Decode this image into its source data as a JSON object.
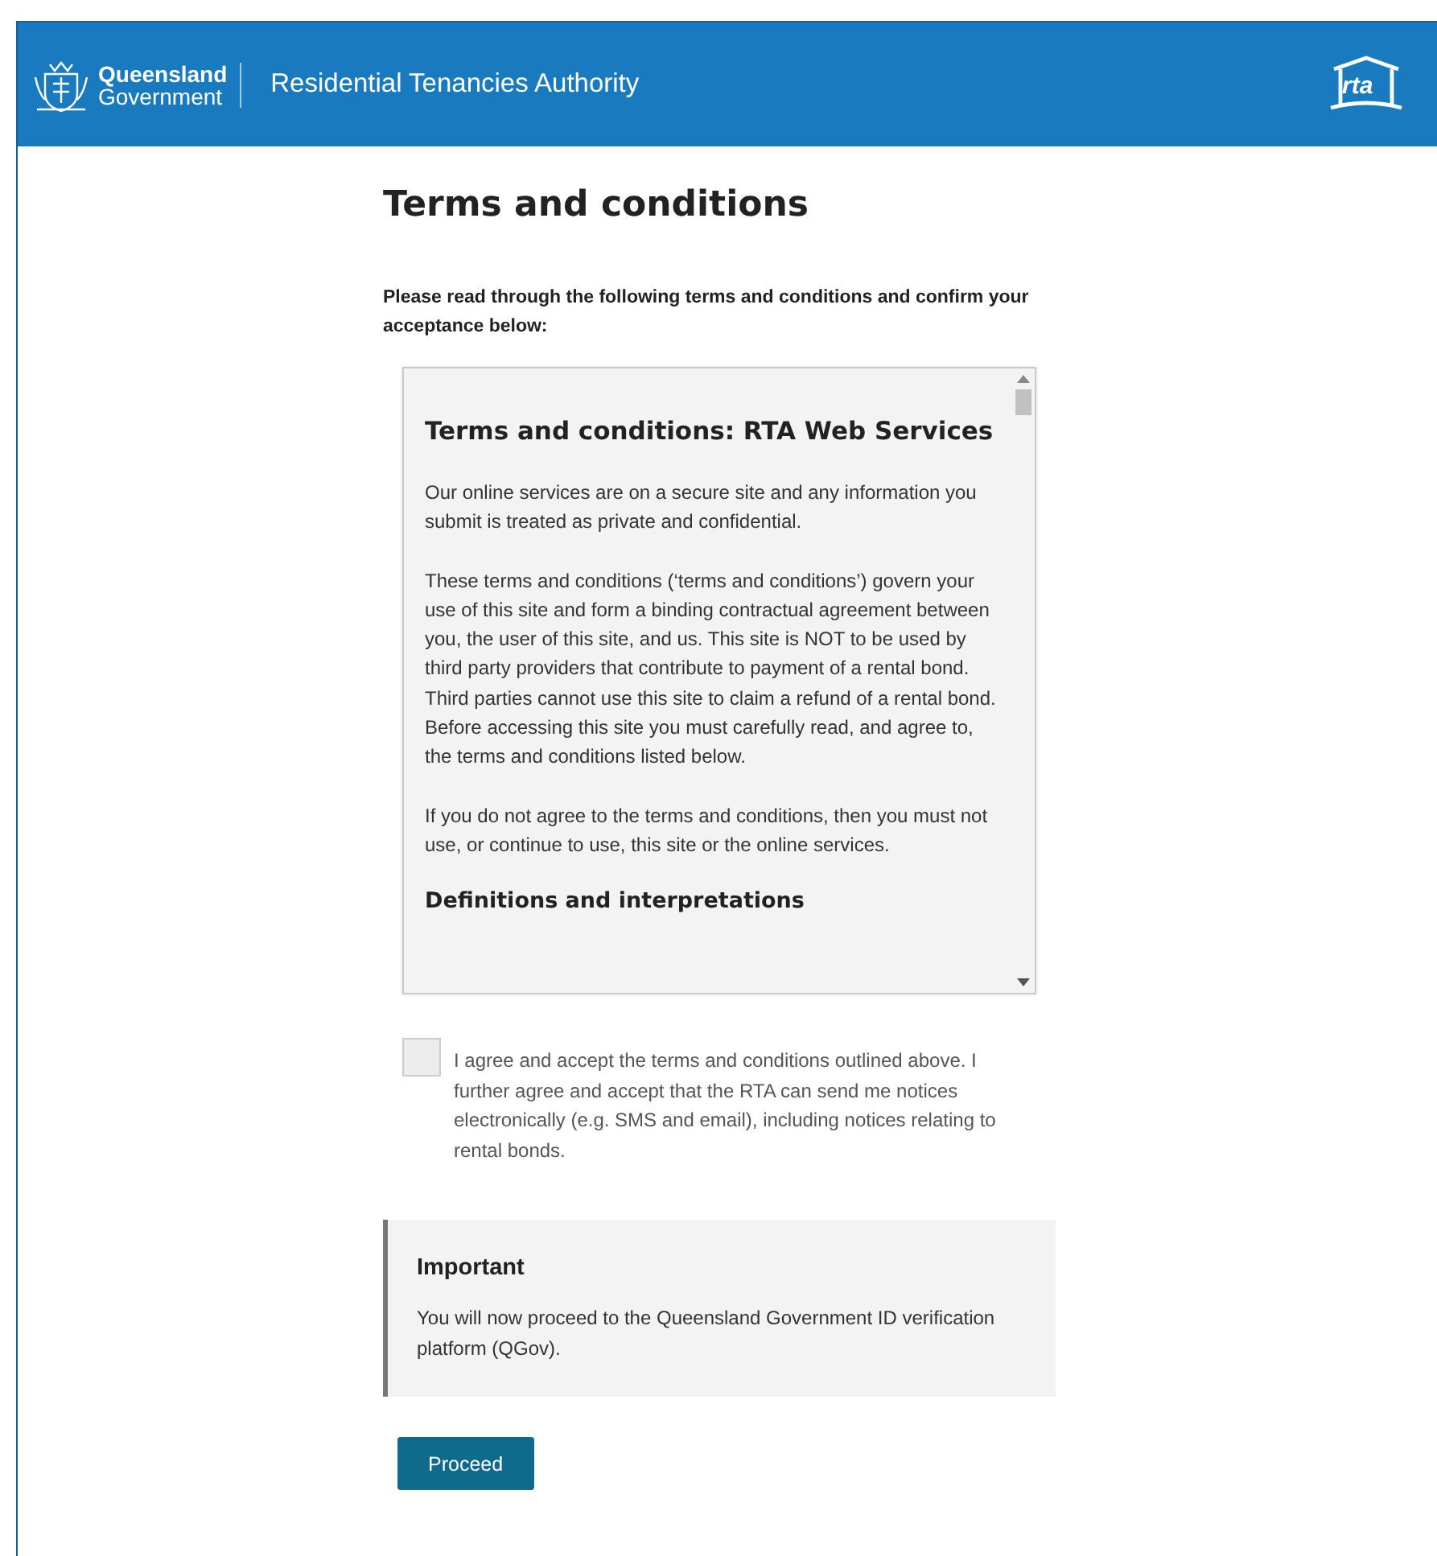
{
  "header": {
    "brand_line_1": "Queensland",
    "brand_line_2": "Government",
    "title": "Residential Tenancies Authority",
    "logo_text": "rta"
  },
  "page_title": "Terms and conditions",
  "intro": "Please read through the following terms and conditions and confirm your acceptance below:",
  "terms_box": {
    "heading": "Terms and conditions: RTA Web Services",
    "paragraphs": [
      "Our online services are on a secure site and any information you submit is treated as private and confidential.",
      "These terms and conditions (‘terms and conditions’) govern your use of this site and form a binding contractual agreement between you, the user of this site, and us. This site is NOT to be used by third party providers that contribute to payment of a rental bond. Third parties cannot use this site to claim a refund of a rental bond. Before accessing this site you must carefully read, and agree to, the terms and conditions listed below.",
      "If you do not agree to the terms and conditions, then you must not use, or continue to use, this site or the online services."
    ],
    "subheading": "Definitions and interpretations"
  },
  "agreement": {
    "label": "I agree and accept the terms and conditions outlined above. I further agree and accept that the RTA can send me notices electronically (e.g. SMS and email), including notices relating to rental bonds.",
    "checked": false
  },
  "notice": {
    "title": "Important",
    "text": "You will now proceed to the Queensland Government ID verification platform (QGov)."
  },
  "buttons": [
    {
      "label": "Proceed"
    }
  ]
}
